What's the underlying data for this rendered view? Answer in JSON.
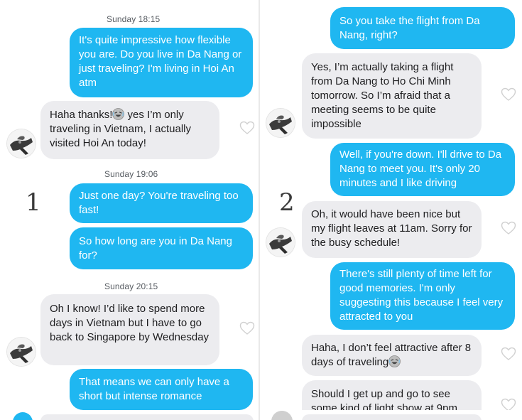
{
  "panel_1": {
    "number": "1",
    "groups": [
      {
        "timestamp": "Sunday 18:15"
      },
      {
        "timestamp": "Sunday 19:06"
      },
      {
        "timestamp": "Sunday 20:15"
      }
    ],
    "messages": [
      {
        "direction": "out",
        "text": "It's quite impressive how flexible you are. Do you live in Da Nang or just traveling? I'm living in Hoi An atm"
      },
      {
        "direction": "in",
        "text_before_emoji": "Haha thanks!",
        "emoji": "laughing-face",
        "text_after_emoji": " yes I’m only traveling in Vietnam, I actually visited Hoi An today!"
      },
      {
        "direction": "out",
        "text": "Just one day? You're traveling too fast!"
      },
      {
        "direction": "out",
        "text": "So how long are you in Da Nang for?"
      },
      {
        "direction": "in",
        "text": "Oh I know! I’d like to spend more days in Vietnam but I have to go back to Singapore by Wednesday"
      },
      {
        "direction": "out",
        "text": "That means we can only have a short but intense romance"
      }
    ]
  },
  "panel_2": {
    "number": "2",
    "messages": [
      {
        "direction": "out",
        "text": "So you take the flight from Da Nang, right?"
      },
      {
        "direction": "in",
        "text": "Yes, I’m actually taking a flight from Da Nang to Ho Chi Minh tomorrow. So I’m afraid that a meeting seems to be quite impossible"
      },
      {
        "direction": "out",
        "text": "Well, if you're down. I'll drive to Da Nang to meet you. It's only 20 minutes and I like driving"
      },
      {
        "direction": "in",
        "text": "Oh, it would have been nice but my flight leaves at 11am. Sorry for the busy schedule!"
      },
      {
        "direction": "out",
        "text": "There's still plenty of time left for good memories. I'm only suggesting this because I feel very attracted to you"
      },
      {
        "direction": "in",
        "text_before_emoji": "Haha, I don’t feel attractive after 8 days of traveling",
        "emoji": "laughing-face",
        "text_after_emoji": ""
      },
      {
        "direction": "in",
        "text": "Should I get up and go to see some kind of light show at 9pm"
      }
    ]
  },
  "colors": {
    "outgoing_bubble": "#1fb7f1",
    "incoming_bubble": "#ececef",
    "timestamp_text": "#555a60",
    "heart_outline": "#d0d0d0"
  },
  "icons": {
    "avatar": "profile-photo",
    "like": "heart-outline-icon",
    "emoji": "laughing-face"
  }
}
